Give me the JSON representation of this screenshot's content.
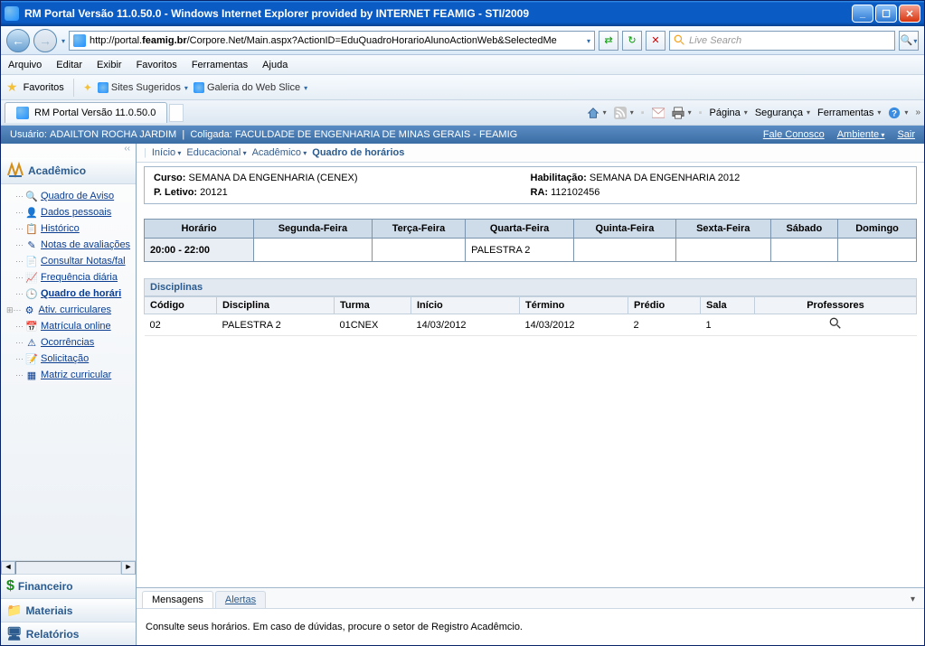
{
  "window": {
    "title": "RM Portal Versão 11.0.50.0 - Windows Internet Explorer provided by INTERNET FEAMIG - STI/2009"
  },
  "nav": {
    "url_prefix": "http://portal.",
    "url_bold": "feamig.br",
    "url_suffix": "/Corpore.Net/Main.aspx?ActionID=EduQuadroHorarioAlunoActionWeb&SelectedMe",
    "refresh_icon": "↻",
    "stop_icon": "✕",
    "search_placeholder": "Live Search"
  },
  "menubar": [
    "Arquivo",
    "Editar",
    "Exibir",
    "Favoritos",
    "Ferramentas",
    "Ajuda"
  ],
  "favbar": {
    "favoritos": "Favoritos",
    "sites": "Sites Sugeridos",
    "galeria": "Galeria do Web Slice"
  },
  "tab": {
    "title": "RM Portal Versão 11.0.50.0"
  },
  "cmdbar": {
    "pagina": "Página",
    "seguranca": "Segurança",
    "ferramentas": "Ferramentas"
  },
  "portal": {
    "user_label": "Usuário:",
    "user_name": "ADAILTON ROCHA JARDIM",
    "sep": "|",
    "colig_label": "Coligada:",
    "colig_name": "FACULDADE DE ENGENHARIA DE MINAS GERAIS - FEAMIG",
    "fale": "Fale Conosco",
    "ambiente": "Ambiente",
    "sair": "Sair"
  },
  "sidebar": {
    "sections": {
      "academico": "Acadêmico",
      "financeiro": "Financeiro",
      "materiais": "Materiais",
      "relatorios": "Relatórios"
    },
    "items": [
      "Quadro de Aviso",
      "Dados pessoais",
      "Histórico",
      "Notas de avaliações",
      "Consultar Notas/fal",
      "Frequência diária",
      "Quadro de horári",
      "Ativ. curriculares",
      "Matrícula online",
      "Ocorrências",
      "Solicitação",
      "Matriz curricular"
    ]
  },
  "breadcrumb": {
    "inicio": "Início",
    "educ": "Educacional",
    "acad": "Acadêmico",
    "current": "Quadro de horários"
  },
  "info": {
    "curso_lbl": "Curso:",
    "curso_val": "SEMANA DA ENGENHARIA (CENEX)",
    "hab_lbl": "Habilitação:",
    "hab_val": "SEMANA DA ENGENHARIA 2012",
    "pl_lbl": "P. Letivo:",
    "pl_val": "20121",
    "ra_lbl": "RA:",
    "ra_val": "112102456"
  },
  "schedule": {
    "headers": [
      "Horário",
      "Segunda-Feira",
      "Terça-Feira",
      "Quarta-Feira",
      "Quinta-Feira",
      "Sexta-Feira",
      "Sábado",
      "Domingo"
    ],
    "row": {
      "hour": "20:00 - 22:00",
      "seg": "",
      "ter": "",
      "qua": "PALESTRA 2",
      "qui": "",
      "sex": "",
      "sab": "",
      "dom": ""
    }
  },
  "disc": {
    "title": "Disciplinas",
    "headers": [
      "Código",
      "Disciplina",
      "Turma",
      "Início",
      "Término",
      "Prédio",
      "Sala",
      "Professores"
    ],
    "row": [
      "02",
      "PALESTRA 2",
      "01CNEX",
      "14/03/2012",
      "14/03/2012",
      "2",
      "1"
    ]
  },
  "messages": {
    "tab1": "Mensagens",
    "tab2": "Alertas",
    "body": "Consulte seus horários. Em caso de dúvidas, procure o setor de Registro Acadêmcio."
  }
}
